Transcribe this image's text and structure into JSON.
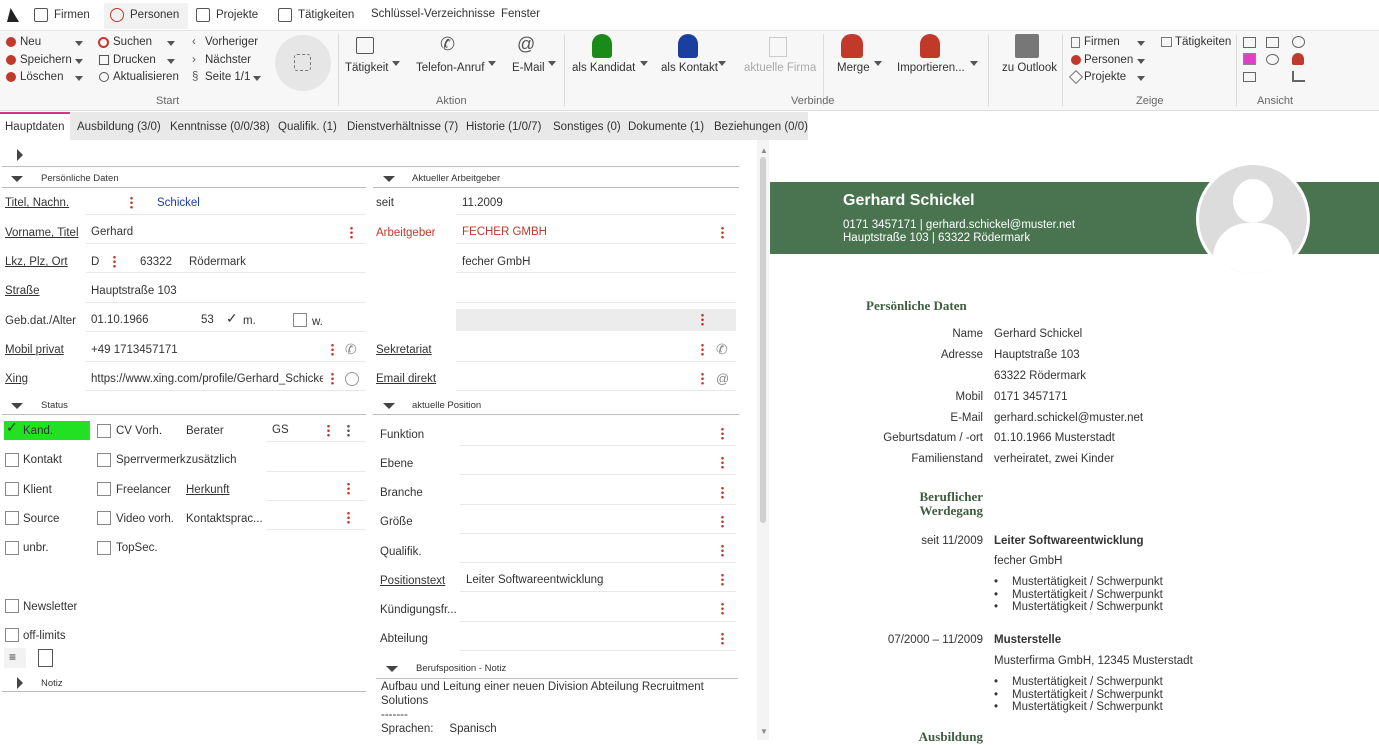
{
  "menu": {
    "firmen": "Firmen",
    "personen": "Personen",
    "projekte": "Projekte",
    "taetigkeiten": "Tätigkeiten",
    "schluessel": "Schlüssel-Verzeichnisse",
    "fenster": "Fenster"
  },
  "ribbon": {
    "neu": "Neu",
    "speichern": "Speichern",
    "loeschen": "Löschen",
    "suchen": "Suchen",
    "drucken": "Drucken",
    "aktualisieren": "Aktualisieren",
    "vorheriger": "Vorheriger",
    "naechster": "Nächster",
    "seite": "Seite 1/1",
    "start": "Start",
    "taetigkeit": "Tätigkeit",
    "telefon": "Telefon-Anruf",
    "email": "E-Mail",
    "aktion": "Aktion",
    "als_kandidat": "als Kandidat",
    "als_kontakt": "als Kontakt",
    "aktuelle_firma": "aktuelle Firma",
    "merge": "Merge",
    "importieren": "Importieren...",
    "verbinde": "Verbinde",
    "zu_outlook": "zu Outlook",
    "z_firmen": "Firmen",
    "z_personen": "Personen",
    "z_projekte": "Projekte",
    "z_taetigkeiten": "Tätigkeiten",
    "zeige": "Zeige",
    "ansicht": "Ansicht"
  },
  "tabs": [
    "Hauptdaten",
    "Ausbildung (3/0)",
    "Kenntnisse (0/0/38)",
    "Qualifik. (1)",
    "Dienstverhältnisse (7)",
    "Historie (1/0/7)",
    "Sonstiges (0)",
    "Dokumente (1)",
    "Beziehungen (0/0)"
  ],
  "personal": {
    "section": "Persönliche Daten",
    "titel_label": "Titel, Nachn.",
    "nachname": "Schickel",
    "vorname_label": "Vorname, Titel",
    "vorname": "Gerhard",
    "lkz_label": "Lkz, Plz, Ort",
    "lkz": "D",
    "plz": "63322",
    "ort": "Rödermark",
    "strasse_label": "Straße",
    "strasse": "Hauptstraße 103",
    "geb_label": "Geb.dat./Alter",
    "geb": "01.10.1966",
    "alter": "53",
    "m": "m.",
    "w": "w.",
    "mobil_label": "Mobil privat",
    "mobil": "+49 1713457171",
    "xing_label": "Xing",
    "xing": "https://www.xing.com/profile/Gerhard_Schickel/cv"
  },
  "employer": {
    "section": "Aktueller Arbeitgeber",
    "seit_label": "seit",
    "seit": "11.2009",
    "arbeitgeber_label": "Arbeitgeber",
    "arbeitgeber": "FECHER GMBH",
    "firma": "fecher GmbH",
    "sekretariat_label": "Sekretariat",
    "email_label": "Email direkt"
  },
  "status": {
    "section": "Status",
    "kand": "Kand.",
    "cv": "CV Vorh.",
    "berater": "Berater",
    "berater_val": "GS",
    "kontakt": "Kontakt",
    "sperr": "Sperrvermerk",
    "zusaetzlich": "zusätzlich",
    "klient": "Klient",
    "freelancer": "Freelancer",
    "herkunft": "Herkunft",
    "source": "Source",
    "video": "Video vorh.",
    "kontaktsprache": "Kontaktsprac...",
    "unbr": "unbr.",
    "topsec": "TopSec.",
    "newsletter": "Newsletter",
    "offlimits": "off-limits",
    "notiz": "Notiz"
  },
  "position": {
    "section": "aktuelle Position",
    "funktion": "Funktion",
    "ebene": "Ebene",
    "branche": "Branche",
    "groesse": "Größe",
    "qualifik": "Qualifik.",
    "positionstext_label": "Positionstext",
    "positionstext": "Leiter Softwareentwicklung",
    "kuendigung": "Kündigungsfr...",
    "abteilung": "Abteilung",
    "notiz_section": "Berufsposition - Notiz",
    "notiz_l1": "Aufbau und Leitung einer neuen Division Abteilung Recruitment",
    "notiz_l2": "Solutions",
    "notiz_l3": "-------",
    "notiz_l4": "Sprachen:     Spanisch"
  },
  "cv": {
    "name": "Gerhard Schickel",
    "contact1": "0171 3457171 | gerhard.schickel@muster.net",
    "contact2": "Hauptstraße 103 | 63322 Rödermark",
    "pd_head": "Persönliche Daten",
    "k_name": "Name",
    "v_name": "Gerhard Schickel",
    "k_adresse": "Adresse",
    "v_adresse1": "Hauptstraße 103",
    "v_adresse2": "63322 Rödermark",
    "k_mobil": "Mobil",
    "v_mobil": "0171 3457171",
    "k_email": "E-Mail",
    "v_email": "gerhard.schickel@muster.net",
    "k_geb": "Geburtsdatum / -ort",
    "v_geb": "01.10.1966 Musterstadt",
    "k_fam": "Familienstand",
    "v_fam": "verheiratet, zwei Kinder",
    "bw_head1": "Beruflicher",
    "bw_head2": "Werdegang",
    "job1_date": "seit 11/2009",
    "job1_title": "Leiter Softwareentwicklung",
    "job1_company": "fecher GmbH",
    "bullet": "Mustertätigkeit / Schwerpunkt",
    "job2_date": "07/2000 – 11/2009",
    "job2_title": "Musterstelle",
    "job2_company": "Musterfirma GmbH, 12345 Musterstadt",
    "ausbildung": "Ausbildung"
  },
  "colors": {
    "accent": "#d63384",
    "banner": "#4a7450",
    "kand_green": "#22e022",
    "label_red": "#c0392b"
  }
}
